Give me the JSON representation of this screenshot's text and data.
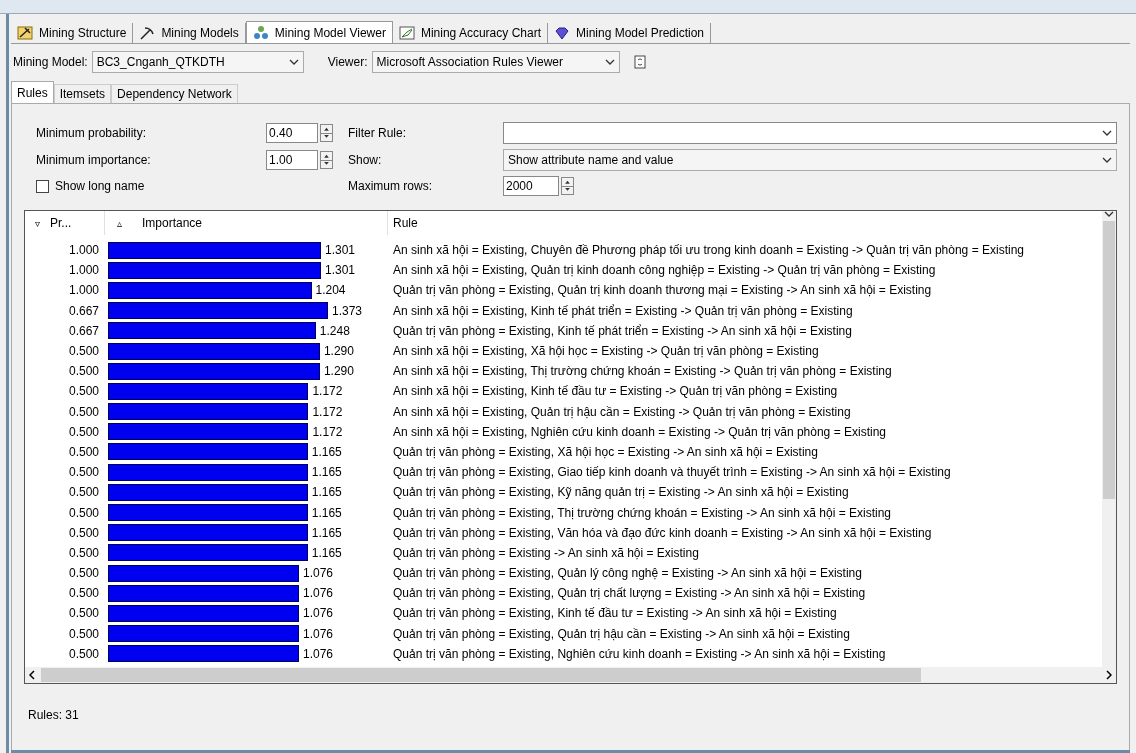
{
  "designer_tabs": [
    {
      "label": "Mining Structure",
      "selected": false
    },
    {
      "label": "Mining Models",
      "selected": false
    },
    {
      "label": "Mining Model Viewer",
      "selected": true
    },
    {
      "label": "Mining Accuracy Chart",
      "selected": false
    },
    {
      "label": "Mining Model Prediction",
      "selected": false
    }
  ],
  "toolbar": {
    "model_label": "Mining Model:",
    "model_value": "BC3_Cnganh_QTKDTH",
    "viewer_label": "Viewer:",
    "viewer_value": "Microsoft Association Rules Viewer"
  },
  "viewer_tabs": [
    {
      "label": "Rules",
      "selected": true
    },
    {
      "label": "Itemsets",
      "selected": false
    },
    {
      "label": "Dependency Network",
      "selected": false
    }
  ],
  "filters": {
    "min_probability_label": "Minimum probability:",
    "min_probability": "0.40",
    "min_importance_label": "Minimum importance:",
    "min_importance": "1.00",
    "show_long_name_label": "Show long name",
    "show_long_name": false,
    "filter_rule_label": "Filter Rule:",
    "show_label": "Show:",
    "show_value": "Show attribute name and value",
    "max_rows_label": "Maximum rows:",
    "max_rows": "2000"
  },
  "table": {
    "columns": [
      {
        "label": "Pr...",
        "sort": "▿"
      },
      {
        "label": "Importance",
        "sort": "▵"
      },
      {
        "label": "Rule"
      }
    ],
    "rows": [
      {
        "probability": "1.000",
        "importance": "1.301",
        "rule": "An sinh xã hội = Existing, Chuyên đề Phương pháp tối ưu trong kinh doanh = Existing -> Quản trị văn phòng = Existing"
      },
      {
        "probability": "1.000",
        "importance": "1.301",
        "rule": "An sinh xã hội = Existing, Quản trị kinh doanh công nghiệp = Existing -> Quản trị văn phòng = Existing"
      },
      {
        "probability": "1.000",
        "importance": "1.204",
        "rule": "Quản trị văn phòng = Existing, Quản trị kinh doanh thương mại = Existing -> An sinh xã hội = Existing"
      },
      {
        "probability": "0.667",
        "importance": "1.373",
        "rule": "An sinh xã hội = Existing, Kinh tế phát triển = Existing -> Quản trị văn phòng = Existing"
      },
      {
        "probability": "0.667",
        "importance": "1.248",
        "rule": "Quản trị văn phòng = Existing, Kinh tế phát triển = Existing -> An sinh xã hội = Existing"
      },
      {
        "probability": "0.500",
        "importance": "1.290",
        "rule": "An sinh xã hội = Existing, Xã hội học = Existing -> Quản trị văn phòng = Existing"
      },
      {
        "probability": "0.500",
        "importance": "1.290",
        "rule": "An sinh xã hội = Existing, Thị trường chứng khoán = Existing -> Quản trị văn phòng = Existing"
      },
      {
        "probability": "0.500",
        "importance": "1.172",
        "rule": "An sinh xã hội = Existing, Kinh tế đầu tư = Existing -> Quản trị văn phòng = Existing"
      },
      {
        "probability": "0.500",
        "importance": "1.172",
        "rule": "An sinh xã hội = Existing, Quản trị hậu cần = Existing -> Quản trị văn phòng = Existing"
      },
      {
        "probability": "0.500",
        "importance": "1.172",
        "rule": "An sinh xã hội = Existing, Nghiên cứu kinh doanh = Existing -> Quản trị văn phòng = Existing"
      },
      {
        "probability": "0.500",
        "importance": "1.165",
        "rule": "Quản trị văn phòng = Existing, Xã hội học = Existing -> An sinh xã hội = Existing"
      },
      {
        "probability": "0.500",
        "importance": "1.165",
        "rule": "Quản trị văn phòng = Existing, Giao tiếp kinh doanh và thuyết trình = Existing -> An sinh xã hội = Existing"
      },
      {
        "probability": "0.500",
        "importance": "1.165",
        "rule": "Quản trị văn phòng = Existing, Kỹ năng quản trị = Existing -> An sinh xã hội = Existing"
      },
      {
        "probability": "0.500",
        "importance": "1.165",
        "rule": "Quản trị văn phòng = Existing, Thị trường chứng khoán = Existing -> An sinh xã hội = Existing"
      },
      {
        "probability": "0.500",
        "importance": "1.165",
        "rule": "Quản trị văn phòng = Existing, Văn hóa và đạo đức kinh doanh = Existing -> An sinh xã hội = Existing"
      },
      {
        "probability": "0.500",
        "importance": "1.165",
        "rule": "Quản trị văn phòng = Existing -> An sinh xã hội = Existing"
      },
      {
        "probability": "0.500",
        "importance": "1.076",
        "rule": "Quản trị văn phòng = Existing, Quản lý công nghệ = Existing -> An sinh xã hội = Existing"
      },
      {
        "probability": "0.500",
        "importance": "1.076",
        "rule": "Quản trị văn phòng = Existing, Quản trị chất lượng = Existing -> An sinh xã hội = Existing"
      },
      {
        "probability": "0.500",
        "importance": "1.076",
        "rule": "Quản trị văn phòng = Existing, Kinh tế đầu tư = Existing -> An sinh xã hội = Existing"
      },
      {
        "probability": "0.500",
        "importance": "1.076",
        "rule": "Quản trị văn phòng = Existing, Quản trị hậu cần = Existing -> An sinh xã hội = Existing"
      },
      {
        "probability": "0.500",
        "importance": "1.076",
        "rule": "Quản trị văn phòng = Existing, Nghiên cứu kinh doanh = Existing -> An sinh xã hội = Existing"
      }
    ]
  },
  "status_bar": {
    "text": "Rules: 31"
  }
}
